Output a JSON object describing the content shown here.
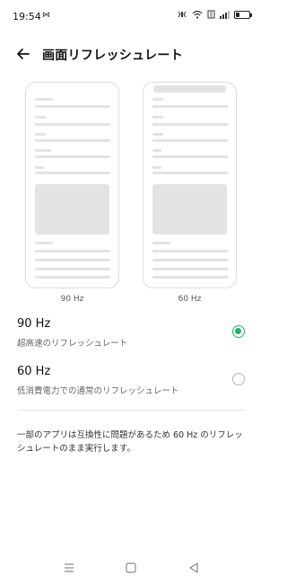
{
  "status_bar": {
    "time": "19:54",
    "left_icon": "⋈",
    "right_icons": [
      "signal-mute",
      "wifi",
      "data",
      "signal-bars"
    ]
  },
  "header": {
    "title": "画面リフレッシュレート",
    "back_icon": "arrow-left-icon"
  },
  "previews": [
    {
      "caption": "90 Hz"
    },
    {
      "caption": "60 Hz"
    }
  ],
  "options": [
    {
      "title": "90 Hz",
      "description": "超高速のリフレッシュレート",
      "selected": true
    },
    {
      "title": "60 Hz",
      "description": "低消費電力での通常のリフレッシュレート",
      "selected": false
    }
  ],
  "note": "一部のアプリは互換性に問題があるため 60 Hz のリフレッシュレートのまま実行します。",
  "colors": {
    "accent": "#1eb56a",
    "placeholder": "#e3e3e3"
  },
  "nav_bar": {
    "buttons": [
      "menu-icon",
      "home-icon",
      "back-triangle-icon"
    ]
  }
}
